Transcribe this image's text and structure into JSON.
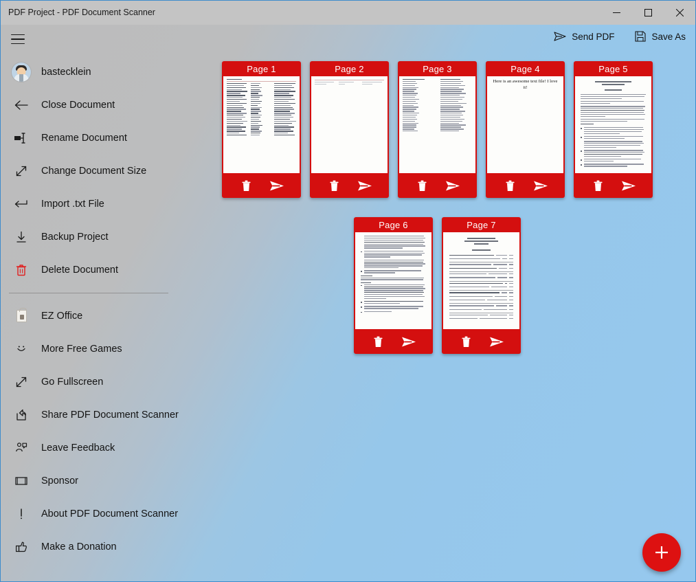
{
  "window": {
    "title": "PDF Project - PDF Document Scanner",
    "controls": [
      {
        "name": "minimize",
        "glyph": "–"
      },
      {
        "name": "maximize",
        "glyph": "□"
      },
      {
        "name": "close",
        "glyph": "✕"
      }
    ],
    "accent_blue": "#3e8ccc",
    "titlebar_color": "#c4c4c4"
  },
  "toolbar": {
    "menu_icon": "hamburger-icon",
    "send_pdf_label": "Send PDF",
    "send_pdf_icon": "send-icon",
    "save_as_label": "Save As",
    "save_as_icon": "floppy-disk-icon"
  },
  "sidebar": {
    "account": {
      "label": "bastecklein",
      "icon": "avatar"
    },
    "items": [
      {
        "label": "Close Document",
        "icon": "arrow-left-icon"
      },
      {
        "label": "Rename Document",
        "icon": "rename-icon"
      },
      {
        "label": "Change Document Size",
        "icon": "resize-diagonal-icon"
      },
      {
        "label": "Import .txt File",
        "icon": "import-arrow-icon"
      },
      {
        "label": "Backup Project",
        "icon": "download-icon"
      },
      {
        "label": "Delete Document",
        "icon": "trash-icon",
        "icon_color": "#e02020"
      }
    ],
    "secondary_items": [
      {
        "label": "EZ Office",
        "icon": "shopping-bag-icon"
      },
      {
        "label": "More Free Games",
        "icon": "smiley-icon"
      },
      {
        "label": "Go Fullscreen",
        "icon": "fullscreen-icon"
      },
      {
        "label": "Share PDF Document Scanner",
        "icon": "share-icon"
      },
      {
        "label": "Leave Feedback",
        "icon": "feedback-person-icon"
      },
      {
        "label": "Sponsor",
        "icon": "sponsor-card-icon"
      },
      {
        "label": "About PDF Document Scanner",
        "icon": "exclamation-icon"
      },
      {
        "label": "Make a Donation",
        "icon": "thumbs-up-icon"
      }
    ]
  },
  "pages": {
    "accent_red": "#d40f0f",
    "delete_icon": "trash-icon",
    "send_icon": "send-icon",
    "items": [
      {
        "title": "Page 1",
        "thumb": "dense-table",
        "text": ""
      },
      {
        "title": "Page 2",
        "thumb": "mostly-blank",
        "text": ""
      },
      {
        "title": "Page 3",
        "thumb": "two-col-list",
        "text": ""
      },
      {
        "title": "Page 4",
        "thumb": "plain-text",
        "text": "Here is an awesome text file! I love it!"
      },
      {
        "title": "Page 5",
        "thumb": "article",
        "text": ""
      },
      {
        "title": "Page 6",
        "thumb": "bullets",
        "text": ""
      },
      {
        "title": "Page 7",
        "thumb": "titled-table",
        "text": ""
      }
    ]
  },
  "fab": {
    "label": "+",
    "icon": "plus-icon",
    "color": "#dd1111"
  }
}
